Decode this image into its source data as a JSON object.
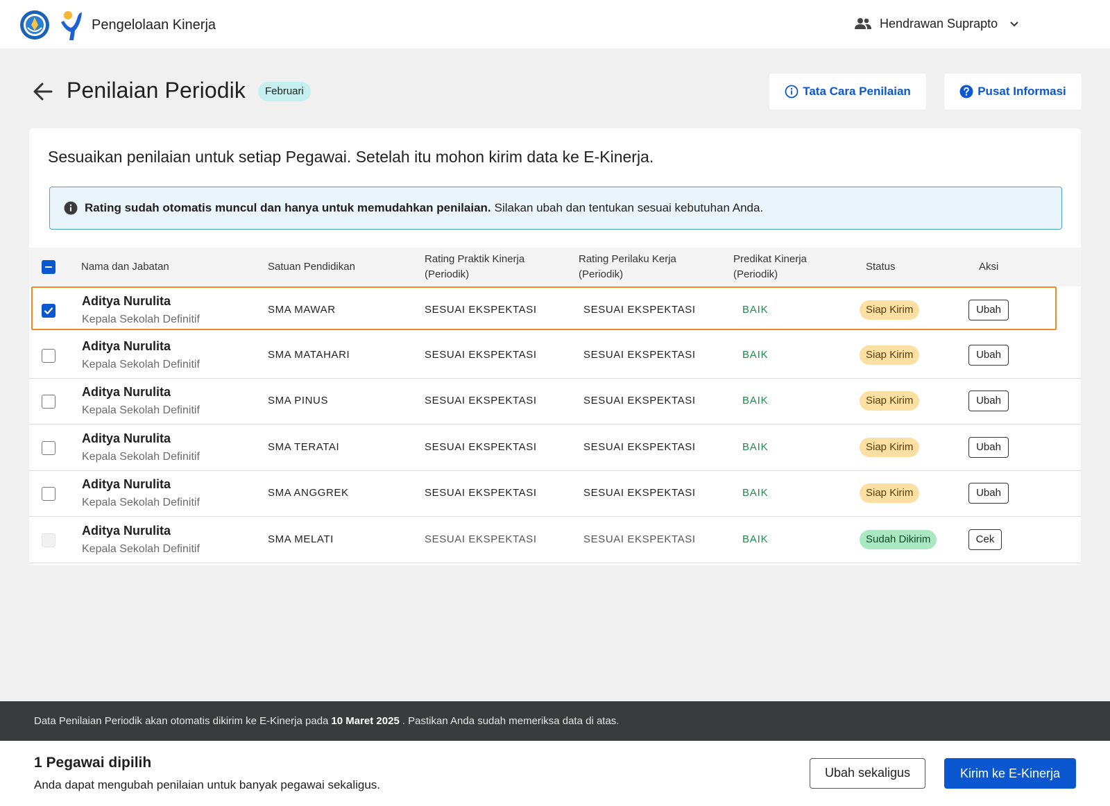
{
  "header": {
    "app_title": "Pengelolaan Kinerja",
    "user_name": "Hendrawan Suprapto",
    "icons": [
      "tut-wuri-handayani-logo",
      "app-logo",
      "users-icon",
      "chevron-down-icon"
    ]
  },
  "page": {
    "title": "Penilaian Periodik",
    "month_badge": "Februari",
    "buttons": {
      "tata_cara": "Tata Cara Penilaian",
      "pusat_informasi": "Pusat Informasi"
    }
  },
  "card": {
    "heading": "Sesuaikan penilaian untuk setiap Pegawai. Setelah itu mohon kirim data ke E-Kinerja.",
    "info_bold": "Rating sudah otomatis muncul dan hanya untuk memudahkan penilaian.",
    "info_text": "Silakan ubah dan tentukan sesuai kebutuhan Anda."
  },
  "table": {
    "headers": {
      "nama": "Nama dan Jabatan",
      "satuan": "Satuan Pendidikan",
      "praktik_1": "Rating Praktik Kinerja",
      "praktik_2": "(Periodik)",
      "perilaku_1": "Rating Perilaku Kerja",
      "perilaku_2": "(Periodik)",
      "predikat_1": "Predikat Kinerja",
      "predikat_2": "(Periodik)",
      "status": "Status",
      "aksi": "Aksi"
    },
    "select_all_state": "indeterminate",
    "rows": [
      {
        "name": "Aditya Nurulita",
        "role": "Kepala Sekolah Definitif",
        "school": "SMA MAWAR",
        "praktik": "SESUAI EKSPEKTASI",
        "perilaku": "SESUAI EKSPEKTASI",
        "predikat": "BAIK",
        "status": "Siap Kirim",
        "action": "Ubah",
        "checked": true
      },
      {
        "name": "Aditya Nurulita",
        "role": "Kepala Sekolah Definitif",
        "school": "SMA MATAHARI",
        "praktik": "SESUAI EKSPEKTASI",
        "perilaku": "SESUAI EKSPEKTASI",
        "predikat": "BAIK",
        "status": "Siap Kirim",
        "action": "Ubah",
        "checked": false
      },
      {
        "name": "Aditya Nurulita",
        "role": "Kepala Sekolah Definitif",
        "school": "SMA PINUS",
        "praktik": "SESUAI EKSPEKTASI",
        "perilaku": "SESUAI EKSPEKTASI",
        "predikat": "BAIK",
        "status": "Siap Kirim",
        "action": "Ubah",
        "checked": false
      },
      {
        "name": "Aditya Nurulita",
        "role": "Kepala Sekolah Definitif",
        "school": "SMA TERATAI",
        "praktik": "SESUAI EKSPEKTASI",
        "perilaku": "SESUAI EKSPEKTASI",
        "predikat": "BAIK",
        "status": "Siap Kirim",
        "action": "Ubah",
        "checked": false
      },
      {
        "name": "Aditya Nurulita",
        "role": "Kepala Sekolah Definitif",
        "school": "SMA ANGGREK",
        "praktik": "SESUAI EKSPEKTASI",
        "perilaku": "SESUAI EKSPEKTASI",
        "predikat": "BAIK",
        "status": "Siap Kirim",
        "action": "Ubah",
        "checked": false
      },
      {
        "name": "Aditya Nurulita",
        "role": "Kepala Sekolah Definitif",
        "school": "SMA MELATI",
        "praktik": "SESUAI EKSPEKTASI",
        "perilaku": "SESUAI EKSPEKTASI",
        "predikat": "BAIK",
        "status": "Sudah Dikirim",
        "action": "Cek",
        "checked": false,
        "disabled": true
      }
    ]
  },
  "footer": {
    "note_before": "Data Penilaian Periodik akan otomatis dikirim ke E-Kinerja pada",
    "note_date": "10 Maret 2025",
    "note_after": ". Pastikan Anda sudah memeriksa data di atas.",
    "selected_count": "1 Pegawai dipilih",
    "selected_hint": "Anda dapat mengubah penilaian untuk banyak pegawai sekaligus.",
    "bulk_edit_label": "Ubah sekaligus",
    "send_label": "Kirim ke E-Kinerja"
  },
  "colors": {
    "primary": "#0b57d0",
    "selected_row_outline": "#f08a24",
    "predikat_green": "#1e8a4c",
    "status_siap_bg": "#fbdfa3",
    "status_sudah_bg": "#a9e8c1",
    "info_box_border": "#4a9fd8"
  }
}
